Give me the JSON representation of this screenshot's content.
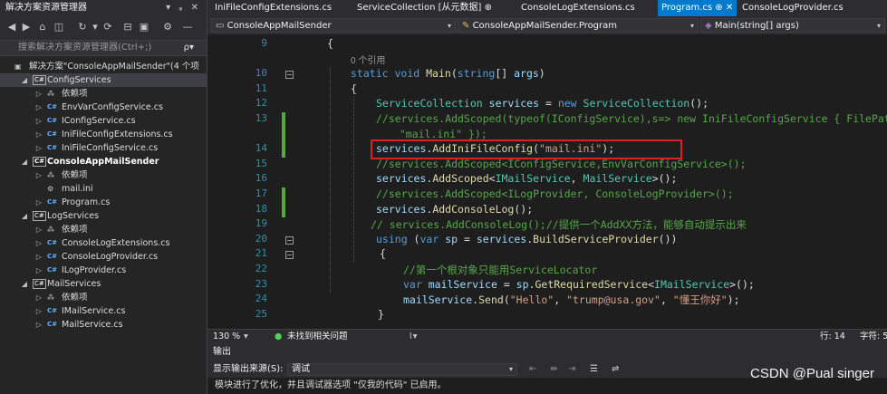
{
  "solution_explorer": {
    "title": "解决方案资源管理器",
    "title_controls": "▾ ᵩ ✕",
    "search_placeholder": "搜索解决方案资源管理器(Ctrl+;)",
    "search_icon": "ρ▾",
    "toolbar_icons": [
      "back-icon",
      "forward-icon",
      "home-icon",
      "vs-icon",
      "sync-icon",
      "sync-dropdown-icon",
      "refresh-icon",
      "collapse-icon",
      "pages-icon",
      "wrench-icon",
      "minus-icon"
    ],
    "tree": [
      {
        "label": "解决方案\"ConsoleAppMailSender\"(4 个项",
        "icon": "solution-icon",
        "indent": 0,
        "arrow": ""
      },
      {
        "label": "ConfigServices",
        "icon": "project-icon",
        "indent": 1,
        "arrow": "◢",
        "selected": true
      },
      {
        "label": "依赖项",
        "icon": "dependencies-icon",
        "indent": 2,
        "arrow": "▷"
      },
      {
        "label": "EnvVarConfigService.cs",
        "icon": "cs-file-icon",
        "indent": 2,
        "arrow": "▷"
      },
      {
        "label": "IConfigService.cs",
        "icon": "cs-file-icon",
        "indent": 2,
        "arrow": "▷"
      },
      {
        "label": "IniFileConfigExtensions.cs",
        "icon": "cs-file-icon",
        "indent": 2,
        "arrow": "▷"
      },
      {
        "label": "IniFileConfigService.cs",
        "icon": "cs-file-icon",
        "indent": 2,
        "arrow": "▷"
      },
      {
        "label": "ConsoleAppMailSender",
        "icon": "project-icon",
        "indent": 1,
        "arrow": "◢",
        "bold": true
      },
      {
        "label": "依赖项",
        "icon": "dependencies-icon",
        "indent": 2,
        "arrow": "▷"
      },
      {
        "label": "mail.ini",
        "icon": "ini-file-icon",
        "indent": 2,
        "arrow": ""
      },
      {
        "label": "Program.cs",
        "icon": "cs-file-icon",
        "indent": 2,
        "arrow": "▷"
      },
      {
        "label": "LogServices",
        "icon": "project-icon",
        "indent": 1,
        "arrow": "◢"
      },
      {
        "label": "依赖项",
        "icon": "dependencies-icon",
        "indent": 2,
        "arrow": "▷"
      },
      {
        "label": "ConsoleLogExtensions.cs",
        "icon": "cs-file-icon",
        "indent": 2,
        "arrow": "▷"
      },
      {
        "label": "ConsoleLogProvider.cs",
        "icon": "cs-file-icon",
        "indent": 2,
        "arrow": "▷"
      },
      {
        "label": "ILogProvider.cs",
        "icon": "cs-file-icon",
        "indent": 2,
        "arrow": "▷"
      },
      {
        "label": "MailServices",
        "icon": "project-icon",
        "indent": 1,
        "arrow": "◢"
      },
      {
        "label": "依赖项",
        "icon": "dependencies-icon",
        "indent": 2,
        "arrow": "▷"
      },
      {
        "label": "IMailService.cs",
        "icon": "cs-file-icon",
        "indent": 2,
        "arrow": "▷"
      },
      {
        "label": "MailService.cs",
        "icon": "cs-file-icon",
        "indent": 2,
        "arrow": "▷"
      }
    ]
  },
  "tabs": [
    {
      "label": "IniFileConfigExtensions.cs",
      "active": false
    },
    {
      "label": "ServiceCollection [从元数据] ⊕",
      "active": false
    },
    {
      "label": "ConsoleLogExtensions.cs",
      "active": false
    },
    {
      "label": "Program.cs ⊕ ✕",
      "active": true
    },
    {
      "label": "ConsoleLogProvider.cs",
      "active": false
    }
  ],
  "navbar": {
    "project": "ConsoleAppMailSender",
    "class": "ConsoleAppMailSender.Program",
    "member": "Main(string[] args)"
  },
  "code_lines": [
    {
      "num": "9",
      "html": "<span>{</span>"
    },
    {
      "num": "",
      "html": "<span class='ref'>0 个引用</span>"
    },
    {
      "num": "10",
      "html": "<span class='kw'>static</span> <span class='kw'>void</span> <span class='mt'>Main</span>(<span class='kw'>string</span>[] <span class='vr'>args</span>)"
    },
    {
      "num": "11",
      "html": "{"
    },
    {
      "num": "12",
      "html": "<span class='ty'>ServiceCollection</span> <span class='vr'>services</span> = <span class='kw'>new</span> <span class='ty'>ServiceCollection</span>();"
    },
    {
      "num": "13",
      "html": "<span class='cm'>//services.AddScoped(typeof(IConfigService),s=&gt; new IniFileConfigService { FilePath=</span>"
    },
    {
      "num": "",
      "html": "<span class='cm'>  \"mail.ini\" });</span>"
    },
    {
      "num": "14",
      "html": "<span class='vr'>services</span>.<span class='mt'>AddIniFileConfig</span>(<span class='st'>\"mail.ini\"</span>);"
    },
    {
      "num": "15",
      "html": "<span class='cm'>//services.AddScoped&lt;IConfigService,EnvVarConfigService&gt;();</span>"
    },
    {
      "num": "16",
      "html": "<span class='vr'>services</span>.<span class='mt'>AddScoped</span>&lt;<span class='ty'>IMailService</span>, <span class='ty'>MailService</span>&gt;();"
    },
    {
      "num": "17",
      "html": "<span class='cm'>//services.AddScoped&lt;ILogProvider, ConsoleLogProvider&gt;();</span>"
    },
    {
      "num": "18",
      "html": "<span class='vr'>services</span>.<span class='mt'>AddConsoleLog</span>();"
    },
    {
      "num": "19",
      "html": "<span class='cm'>// services.AddConsoleLog();//提供一个AddXX方法，能够自动提示出来</span>"
    },
    {
      "num": "20",
      "html": "<span class='kw'>using</span> (<span class='kw'>var</span> <span class='vr'>sp</span> = <span class='vr'>services</span>.<span class='mt'>BuildServiceProvider</span>())"
    },
    {
      "num": "21",
      "html": "{"
    },
    {
      "num": "22",
      "html": "<span class='cm'>//第一个根对象只能用ServiceLocator</span>"
    },
    {
      "num": "23",
      "html": "<span class='kw'>var</span> <span class='vr'>mailService</span> = <span class='vr'>sp</span>.<span class='mt'>GetRequiredService</span>&lt;<span class='ty'>IMailService</span>&gt;();"
    },
    {
      "num": "24",
      "html": "<span class='vr'>mailService</span>.<span class='mt'>Send</span>(<span class='st'>\"Hello\"</span>, <span class='st'>\"trump@usa.gov\"</span>, <span class='st'>\"懂王你好\"</span>);"
    },
    {
      "num": "25",
      "html": "}"
    }
  ],
  "editor_status": {
    "zoom": "130 %",
    "issues": "未找到相关问题",
    "line": "行: 14",
    "col": "字符: 5"
  },
  "output": {
    "title": "输出",
    "source_label": "显示输出来源(S):",
    "source_value": "调试",
    "text": "模块进行了优化，并且调试器选项 \"仅我的代码\" 已启用。"
  },
  "watermark": "CSDN @Pual singer"
}
